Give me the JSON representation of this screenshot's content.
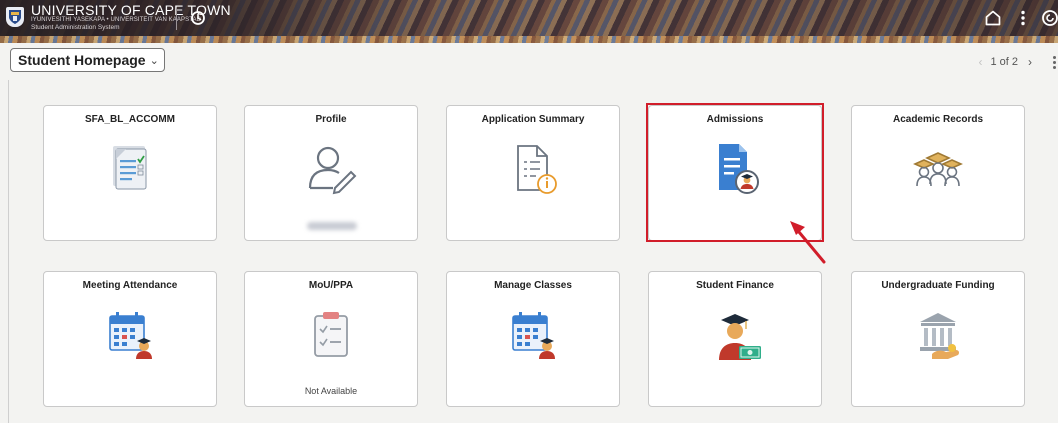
{
  "header": {
    "university_name": "UNIVERSITY OF CAPE TOWN",
    "university_sub": "IYUNIVESITHI YASEKAPA • UNIVERSITEIT VAN KAAPSTAD",
    "system_name": "Student Administration System",
    "icons": [
      "uct-crest-icon",
      "clock-icon",
      "home-icon",
      "kebab-menu-icon",
      "navbar-icon"
    ]
  },
  "subheader": {
    "homepage_label": "Student Homepage",
    "pager_text": "1 of 2"
  },
  "tiles": [
    {
      "title": "SFA_BL_ACCOMM",
      "icon": "document-checklist-icon",
      "footer": ""
    },
    {
      "title": "Profile",
      "icon": "user-edit-icon",
      "footer": "(blurred)"
    },
    {
      "title": "Application Summary",
      "icon": "document-info-icon",
      "footer": ""
    },
    {
      "title": "Admissions",
      "icon": "admissions-document-icon",
      "footer": ""
    },
    {
      "title": "Academic Records",
      "icon": "graduates-icon",
      "footer": ""
    },
    {
      "title": "Meeting Attendance",
      "icon": "calendar-student-icon",
      "footer": ""
    },
    {
      "title": "MoU/PPA",
      "icon": "clipboard-checklist-icon",
      "footer": "Not Available"
    },
    {
      "title": "Manage Classes",
      "icon": "calendar-student-icon",
      "footer": ""
    },
    {
      "title": "Student Finance",
      "icon": "student-money-icon",
      "footer": ""
    },
    {
      "title": "Undergraduate Funding",
      "icon": "bank-funding-icon",
      "footer": ""
    }
  ],
  "annotation": {
    "highlighted_tile": "Admissions",
    "color": "#d11d2a"
  },
  "colors": {
    "tile_icon_blue": "#3a7fd0",
    "accent_orange": "#f0a030",
    "highlight_red": "#d11d2a"
  }
}
